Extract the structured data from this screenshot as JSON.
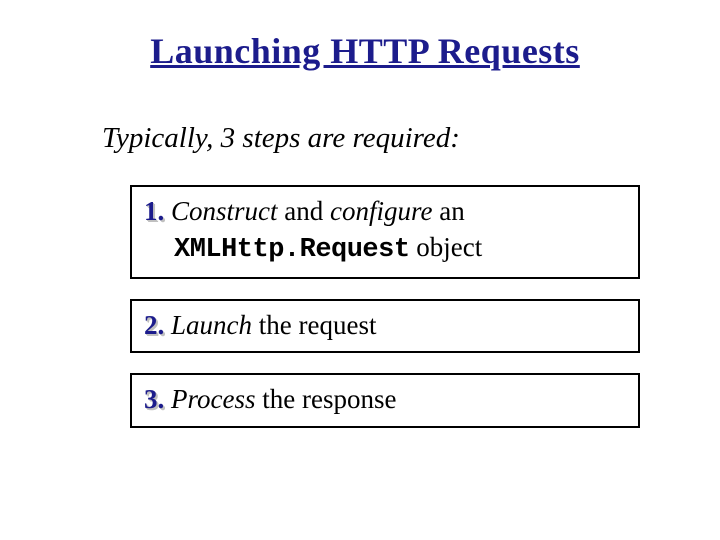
{
  "title": "Launching HTTP Requests",
  "subtitle": "Typically, 3 steps are required:",
  "steps": [
    {
      "num": "1.",
      "word_construct": "Construct",
      "word_and": " and ",
      "word_configure": "configure",
      "word_an": " an",
      "code": "XMLHttp.Request",
      "word_object": " object"
    },
    {
      "num": "2.",
      "word_launch": "Launch",
      "rest": " the request"
    },
    {
      "num": "3.",
      "word_process": "Process",
      "rest": " the response"
    }
  ]
}
